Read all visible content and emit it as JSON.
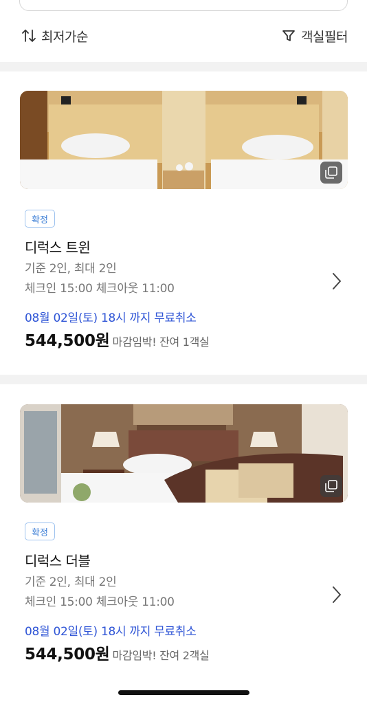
{
  "toolbar": {
    "sort_label": "최저가순",
    "sort_icon": "sort-arrows-icon",
    "filter_label": "객실필터",
    "filter_icon": "filter-funnel-icon"
  },
  "rooms": [
    {
      "status": "확정",
      "name": "디럭스 트윈",
      "occupancy": "기준 2인, 최대 2인",
      "checkin": "체크인 15:00 체크아웃 11:00",
      "cancel": "08월 02일(토) 18시 까지 무료취소",
      "price": "544,500원",
      "stock": "마감임박! 잔여 1객실"
    },
    {
      "status": "확정",
      "name": "디럭스 더블",
      "occupancy": "기준 2인, 최대 2인",
      "checkin": "체크인 15:00 체크아웃 11:00",
      "cancel": "08월 02일(토) 18시 까지 무료취소",
      "price": "544,500원",
      "stock": "마감임박! 잔여 2객실"
    }
  ],
  "colors": {
    "accent_blue": "#2f55d6",
    "badge_blue": "#3d7fd6",
    "divider": "#f2f2f2"
  }
}
